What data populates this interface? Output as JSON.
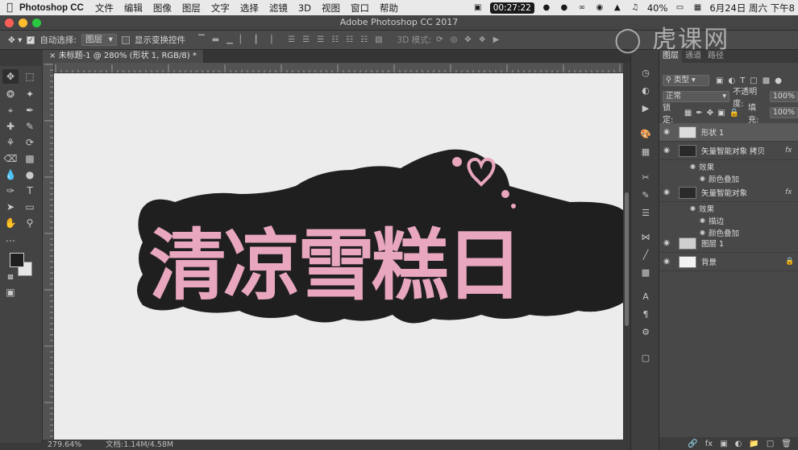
{
  "menubar": {
    "app_name": "Photoshop CC",
    "items": [
      "文件",
      "编辑",
      "图像",
      "图层",
      "文字",
      "选择",
      "滤镜",
      "3D",
      "视图",
      "窗口",
      "帮助"
    ],
    "clock_pill": "00:27:22",
    "battery": "40%",
    "datetime": "6月24日 周六 下午8"
  },
  "window": {
    "title": "Adobe Photoshop CC 2017"
  },
  "options": {
    "auto_select_label": "自动选择:",
    "auto_select_value": "图层",
    "show_transform_label": "显示变换控件",
    "mode_3d_label": "3D 模式:"
  },
  "document": {
    "tab_label": "未标题-1 @ 280% (形状 1, RGB/8) *",
    "zoom": "279.64%",
    "doc_size": "文档:1.14M/4.58M"
  },
  "artwork": {
    "text": "清凉雪糕日",
    "fill_color": "#e8a6bf",
    "stroke_color": "#222222"
  },
  "layers_panel": {
    "tabs": [
      "图层",
      "通道",
      "路径"
    ],
    "kind_label": "类型",
    "blend_mode": "正常",
    "opacity_label": "不透明度:",
    "opacity_value": "100%",
    "lock_label": "锁定:",
    "fill_label": "填充:",
    "fill_value": "100%",
    "layers": [
      {
        "name": "形状 1"
      },
      {
        "name": "矢量智能对象 拷贝",
        "fx": "fx",
        "effects_label": "效果",
        "effects": [
          "颜色叠加"
        ]
      },
      {
        "name": "矢量智能对象",
        "fx": "fx",
        "effects_label": "效果",
        "effects": [
          "描边",
          "颜色叠加"
        ]
      },
      {
        "name": "图层 1"
      },
      {
        "name": "背景"
      }
    ]
  },
  "watermark": "虎课网"
}
